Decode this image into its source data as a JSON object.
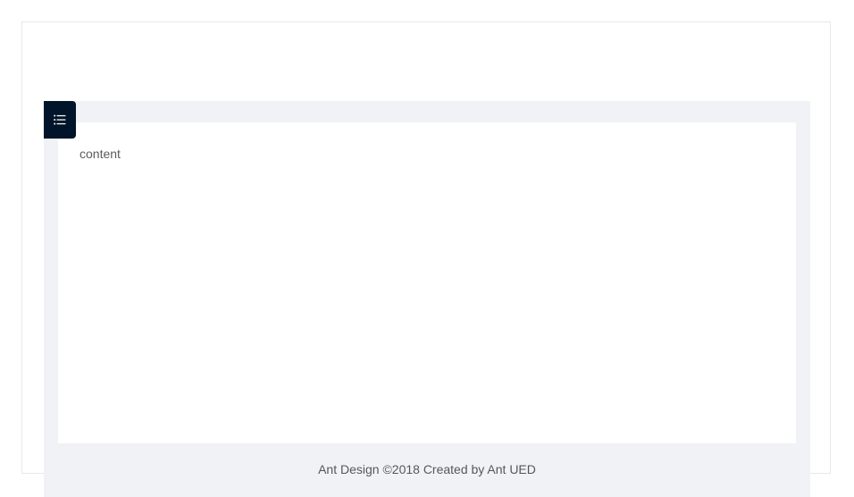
{
  "sider": {
    "trigger_icon": "bars-icon"
  },
  "main": {
    "content_text": "content"
  },
  "footer": {
    "text": "Ant Design ©2018 Created by Ant UED"
  },
  "colors": {
    "trigger_bg": "#001529",
    "layout_bg": "#f0f2f5",
    "panel_bg": "#ffffff"
  }
}
